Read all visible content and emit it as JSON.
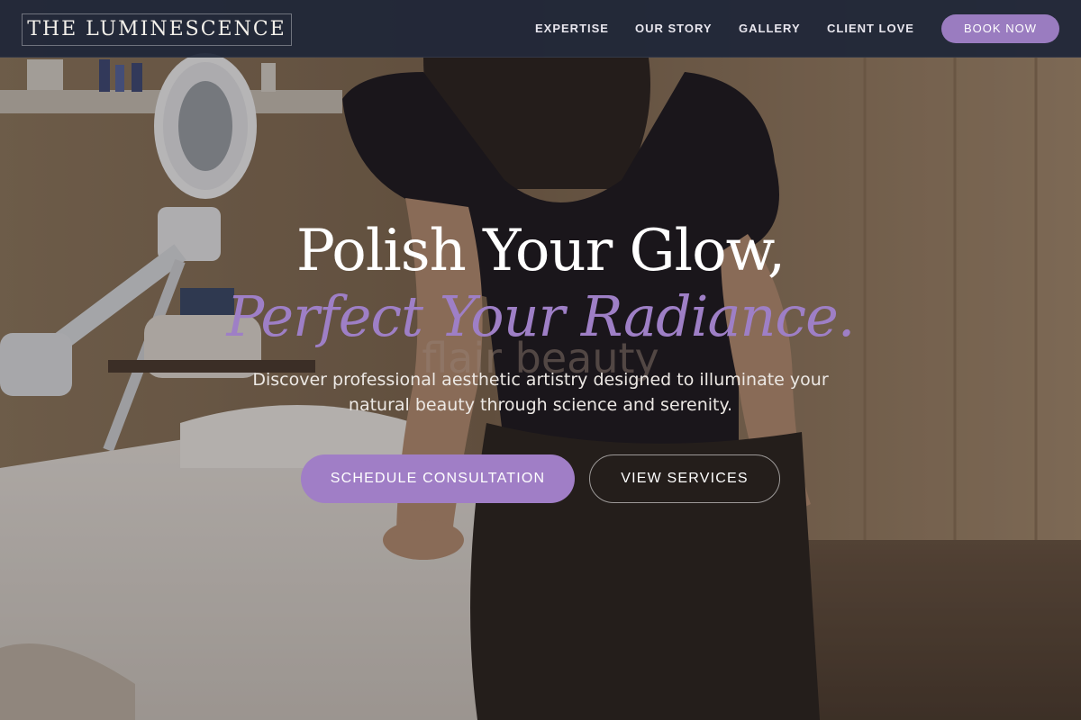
{
  "header": {
    "logo_text": "THE LUMINESCENCE",
    "nav": {
      "expertise": "EXPERTISE",
      "our_story": "OUR STORY",
      "gallery": "GALLERY",
      "client_love": "CLIENT LOVE"
    },
    "book_now": "BOOK NOW"
  },
  "hero": {
    "headline_line1": "Polish Your Glow,",
    "headline_line2": "Perfect Your Radiance.",
    "photo_watermark": "flair beauty",
    "subtitle": "Discover professional aesthetic artistry designed to illuminate your natural beauty through science and serenity.",
    "primary_cta": "SCHEDULE CONSULTATION",
    "secondary_cta": "VIEW SERVICES"
  },
  "colors": {
    "accent_purple": "#9a7cc0",
    "header_navy": "#1e2638",
    "headline_white": "#ffffff"
  }
}
